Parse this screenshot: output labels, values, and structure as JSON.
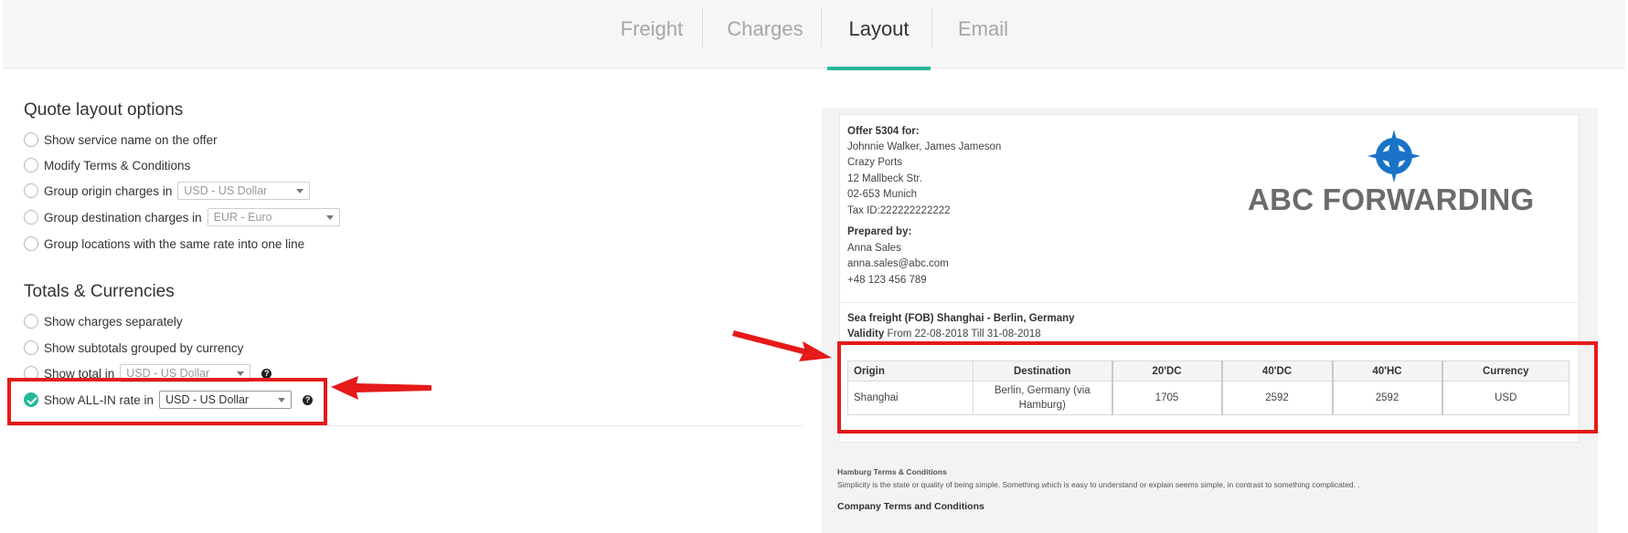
{
  "tabs": [
    {
      "label": "Freight"
    },
    {
      "label": "Charges"
    },
    {
      "label": "Layout"
    },
    {
      "label": "Email"
    }
  ],
  "layout_options": {
    "title": "Quote layout options",
    "show_service_name": "Show service name on the offer",
    "modify_terms": "Modify Terms & Conditions",
    "group_origin": "Group origin charges in",
    "group_origin_value": "USD - US Dollar",
    "group_destination": "Group destination charges in",
    "group_destination_value": "EUR - Euro",
    "group_locations": "Group locations with the same rate into one line"
  },
  "totals": {
    "title": "Totals & Currencies",
    "show_separately": "Show charges separately",
    "show_subtotals": "Show subtotals grouped by currency",
    "show_total": "Show total in",
    "show_total_value": "USD - US Dollar",
    "show_all_in": "Show ALL-IN rate in",
    "show_all_in_value": "USD - US Dollar",
    "help_glyph": "?"
  },
  "preview": {
    "offer_title": "Offer 5304 for:",
    "client_name": "Johnnie Walker, James Jameson",
    "company": "Crazy Ports",
    "street": "12 Mallbeck Str.",
    "city": "02-653 Munich",
    "tax": "Tax ID:222222222222",
    "prepared_by": "Prepared by:",
    "agent_name": "Anna Sales",
    "agent_email": "anna.sales@abc.com",
    "agent_phone": "+48 123 456 789",
    "logo_text": "ABC FORWARDING",
    "freight_title": "Sea freight (FOB) Shanghai - Berlin, Germany",
    "validity_label": "Validity",
    "validity_value": "From 22-08-2018 Till 31-08-2018",
    "table": {
      "headers": [
        "Origin",
        "Destination",
        "20'DC",
        "40'DC",
        "40'HC",
        "Currency"
      ],
      "row": [
        "Shanghai",
        "Berlin, Germany (via Hamburg)",
        "1705",
        "2592",
        "2592",
        "USD"
      ]
    },
    "hamburg_terms_title": "Hamburg Terms & Conditions",
    "hamburg_terms_text": "Simplicity is the state or quality of being simple. Something which is easy to understand or explain seems simple, in contrast to something complicated. .",
    "company_terms_title": "Company Terms and Conditions"
  },
  "colors": {
    "accent": "#25b89a",
    "highlight": "#e51a1a"
  }
}
